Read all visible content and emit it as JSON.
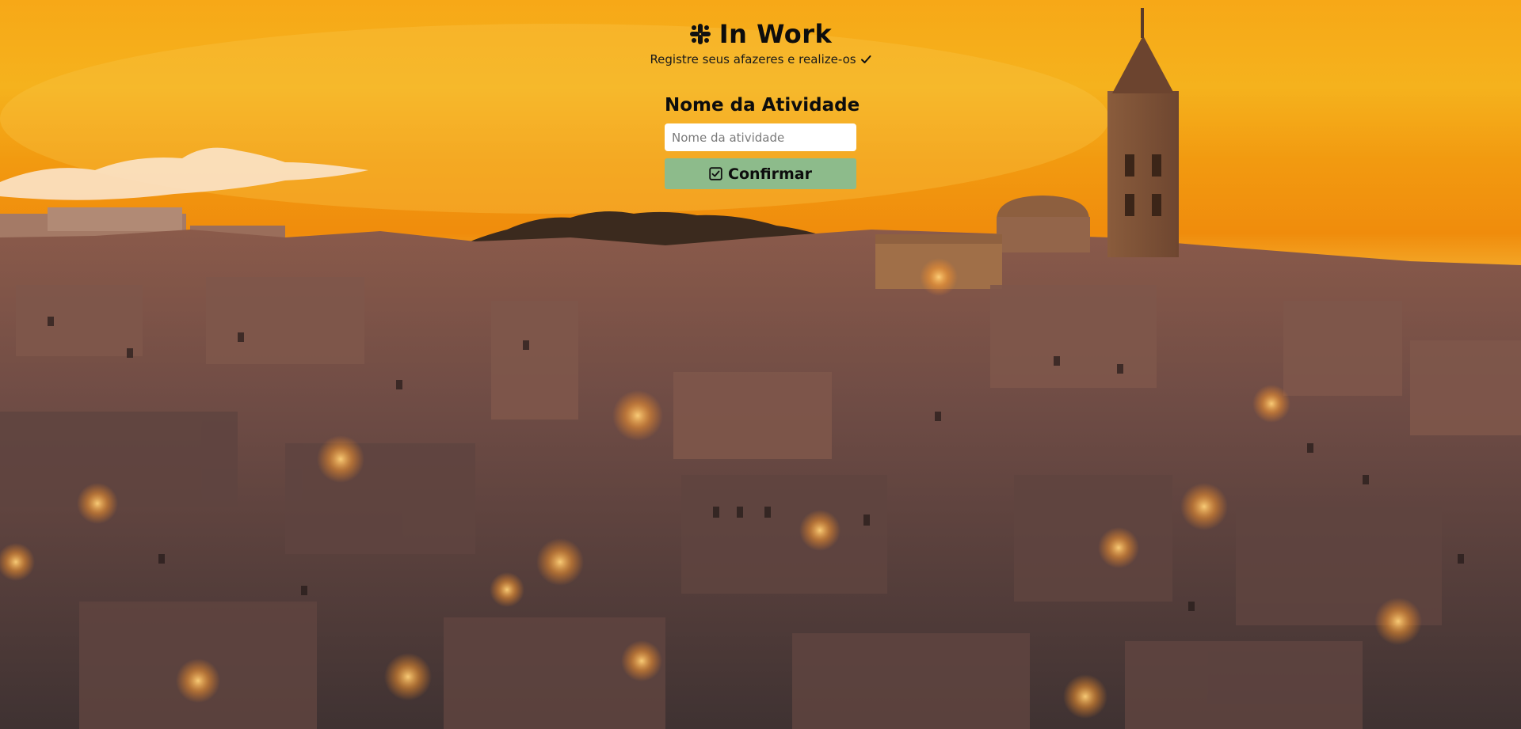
{
  "app": {
    "title": "In Work",
    "tagline": "Registre seus afazeres e realize-os",
    "brand_icon": "slack-hash-icon"
  },
  "form": {
    "label": "Nome da Atividade",
    "input_value": "",
    "input_placeholder": "Nome da atividade",
    "confirm_label": "Confirmar",
    "confirm_icon": "check-square-icon"
  },
  "colors": {
    "sky": "#f2a51a",
    "button": "#8dbb8b",
    "input_bg": "#ffffff",
    "text": "#0d0d0d"
  }
}
